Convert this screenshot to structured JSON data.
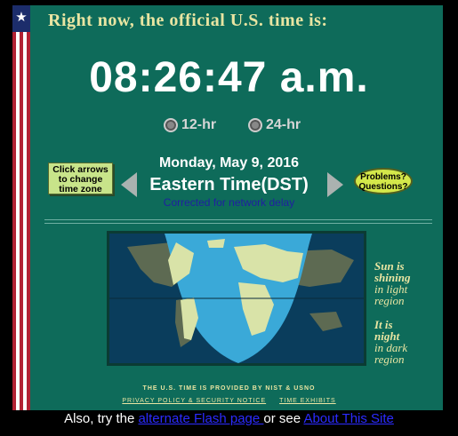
{
  "header": {
    "title": "Right now, the official U.S. time is:"
  },
  "clock": {
    "time": "08:26:47 a.m."
  },
  "format": {
    "opt12": "12-hr",
    "opt24": "24-hr"
  },
  "date": "Monday, May 9, 2016",
  "timezone": "Eastern Time(DST)",
  "corrected": "Corrected for network delay",
  "change_zone": {
    "line1": "Click arrows",
    "line2": "to change",
    "line3": "time zone"
  },
  "problems": {
    "line1": "Problems?",
    "line2": "Questions?"
  },
  "sun_text": {
    "bold1": "Sun is",
    "bold2": "shining",
    "norm1": "in light",
    "norm2": "region"
  },
  "night_text": {
    "bold1": "It is",
    "bold2": "night",
    "norm1": "in dark",
    "norm2": "region"
  },
  "footer": {
    "provided": "THE U.S. TIME IS PROVIDED BY NIST & USNO",
    "privacy": "PRIVACY POLICY & SECURITY NOTICE",
    "exhibits": "TIME EXHIBITS"
  },
  "bottom": {
    "prefix": "Also, try the ",
    "flash_link": "alternate Flash page ",
    "middle": "or see ",
    "about_link": "About This Site"
  },
  "colors": {
    "panel": "#0e6b5a",
    "headline": "#e9e5a2",
    "link": "#2b2bff"
  }
}
